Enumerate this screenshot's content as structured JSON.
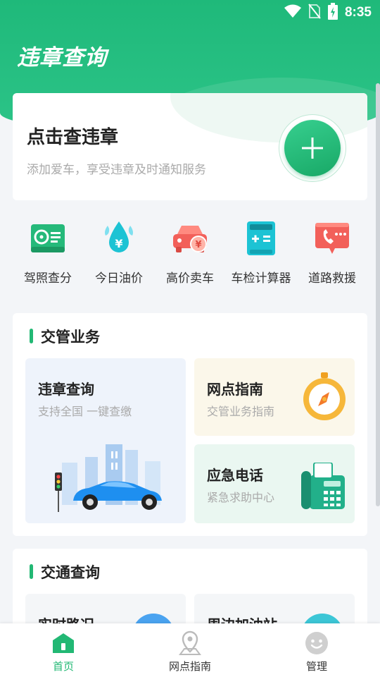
{
  "status_bar": {
    "time": "8:35"
  },
  "app": {
    "title": "违章查询"
  },
  "hero": {
    "title": "点击查违章",
    "subtitle": "添加爱车，享受违章及时通知服务"
  },
  "quick_actions": [
    {
      "label": "驾照查分",
      "icon": "license-icon"
    },
    {
      "label": "今日油价",
      "icon": "oil-price-icon"
    },
    {
      "label": "高价卖车",
      "icon": "sell-car-icon"
    },
    {
      "label": "车检计算器",
      "icon": "calculator-icon"
    },
    {
      "label": "道路救援",
      "icon": "rescue-phone-icon"
    }
  ],
  "traffic_services": {
    "title": "交管业务",
    "tiles": [
      {
        "title": "违章查询",
        "subtitle": "支持全国 一键查缴"
      },
      {
        "title": "网点指南",
        "subtitle": "交管业务指南"
      },
      {
        "title": "应急电话",
        "subtitle": "紧急求助中心"
      }
    ]
  },
  "traffic_query": {
    "title": "交通查询",
    "tiles": [
      {
        "title": "实时路况"
      },
      {
        "title": "周边加油站"
      }
    ]
  },
  "bottom_nav": [
    {
      "label": "首页",
      "icon": "home-icon",
      "active": true
    },
    {
      "label": "网点指南",
      "icon": "map-pin-icon",
      "active": false
    },
    {
      "label": "管理",
      "icon": "smiley-icon",
      "active": false
    }
  ],
  "colors": {
    "brand": "#22b874",
    "header": "#1fb97a"
  }
}
